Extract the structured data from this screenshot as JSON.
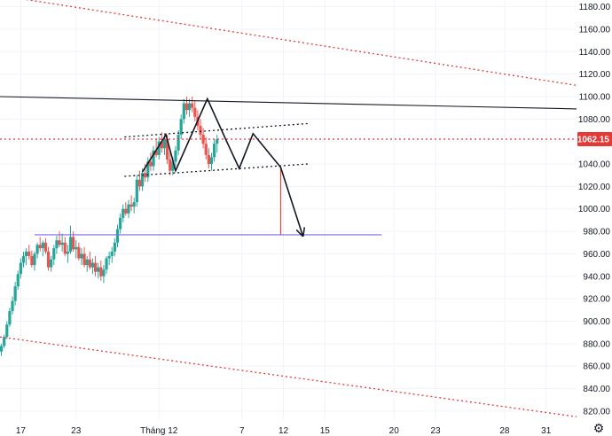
{
  "chart_data": {
    "type": "candlestick",
    "y_ticks": [
      820,
      840,
      860,
      880,
      900,
      920,
      940,
      960,
      980,
      1000,
      1020,
      1040,
      1060,
      1080,
      1100,
      1120,
      1140,
      1160,
      1180
    ],
    "y_tick_labels": [
      "820.00",
      "840.00",
      "860.00",
      "880.00",
      "900.00",
      "920.00",
      "940.00",
      "960.00",
      "980.00",
      "1000.00",
      "1020.00",
      "1040.00",
      "1060.00",
      "1080.00",
      "1100.00",
      "1120.00",
      "1140.00",
      "1160.00",
      "1180.00"
    ],
    "ylim": [
      812,
      1186
    ],
    "x_ticks": [
      {
        "label": "17",
        "x": 0
      },
      {
        "label": "23",
        "x": 4
      },
      {
        "label": "Tháng 12",
        "x": 10
      },
      {
        "label": "7",
        "x": 16
      },
      {
        "label": "12",
        "x": 19
      },
      {
        "label": "15",
        "x": 22
      },
      {
        "label": "20",
        "x": 27
      },
      {
        "label": "23",
        "x": 30
      },
      {
        "label": "28",
        "x": 35
      },
      {
        "label": "31",
        "x": 38
      }
    ],
    "xlim": [
      -1.5,
      40.2
    ],
    "current_price": 1062.15,
    "current_price_label": "1062.15",
    "up_color": "#26a69a",
    "down_color": "#ef5350",
    "candles": [
      [
        -1.4,
        873,
        880,
        869,
        878
      ],
      [
        -1.2,
        878,
        888,
        876,
        886
      ],
      [
        -1.0,
        886,
        900,
        884,
        897
      ],
      [
        -0.8,
        897,
        912,
        895,
        909
      ],
      [
        -0.6,
        909,
        922,
        906,
        918
      ],
      [
        -0.4,
        918,
        935,
        914,
        931
      ],
      [
        -0.2,
        931,
        945,
        928,
        942
      ],
      [
        0.0,
        942,
        956,
        938,
        952
      ],
      [
        0.2,
        952,
        962,
        948,
        958
      ],
      [
        0.4,
        958,
        965,
        950,
        962
      ],
      [
        0.6,
        962,
        968,
        955,
        958
      ],
      [
        0.8,
        958,
        963,
        948,
        950
      ],
      [
        1.0,
        950,
        962,
        945,
        960
      ],
      [
        1.2,
        960,
        970,
        956,
        968
      ],
      [
        1.4,
        968,
        975,
        962,
        965
      ],
      [
        1.6,
        965,
        972,
        958,
        970
      ],
      [
        1.8,
        970,
        974,
        960,
        962
      ],
      [
        2.0,
        962,
        966,
        945,
        948
      ],
      [
        2.2,
        948,
        958,
        944,
        955
      ],
      [
        2.4,
        955,
        968,
        950,
        965
      ],
      [
        2.6,
        965,
        976,
        960,
        972
      ],
      [
        2.8,
        972,
        980,
        966,
        968
      ],
      [
        3.0,
        968,
        978,
        962,
        970
      ],
      [
        3.2,
        970,
        975,
        958,
        960
      ],
      [
        3.4,
        960,
        968,
        952,
        962
      ],
      [
        3.6,
        962,
        985,
        960,
        975
      ],
      [
        3.8,
        975,
        980,
        962,
        964
      ],
      [
        4.0,
        964,
        972,
        956,
        966
      ],
      [
        4.2,
        966,
        970,
        954,
        956
      ],
      [
        4.4,
        956,
        965,
        950,
        960
      ],
      [
        4.6,
        960,
        966,
        948,
        950
      ],
      [
        4.8,
        950,
        958,
        944,
        955
      ],
      [
        5.0,
        955,
        962,
        946,
        948
      ],
      [
        5.2,
        948,
        956,
        942,
        952
      ],
      [
        5.4,
        952,
        958,
        940,
        944
      ],
      [
        5.6,
        944,
        952,
        938,
        948
      ],
      [
        5.8,
        948,
        954,
        936,
        940
      ],
      [
        6.0,
        940,
        950,
        934,
        946
      ],
      [
        6.2,
        946,
        958,
        942,
        956
      ],
      [
        6.4,
        956,
        962,
        950,
        958
      ],
      [
        6.6,
        958,
        966,
        952,
        962
      ],
      [
        6.8,
        962,
        974,
        958,
        970
      ],
      [
        7.0,
        970,
        986,
        966,
        982
      ],
      [
        7.2,
        982,
        996,
        978,
        992
      ],
      [
        7.4,
        992,
        1004,
        988,
        1000
      ],
      [
        7.6,
        1000,
        1006,
        994,
        996
      ],
      [
        7.8,
        996,
        1008,
        992,
        1004
      ],
      [
        8.0,
        1004,
        1012,
        998,
        1002
      ],
      [
        8.2,
        1002,
        1010,
        996,
        1006
      ],
      [
        8.4,
        1006,
        1030,
        1002,
        1026
      ],
      [
        8.6,
        1026,
        1034,
        1016,
        1020
      ],
      [
        8.8,
        1020,
        1036,
        1016,
        1032
      ],
      [
        9.0,
        1032,
        1040,
        1024,
        1028
      ],
      [
        9.2,
        1028,
        1046,
        1024,
        1042
      ],
      [
        9.4,
        1042,
        1050,
        1034,
        1038
      ],
      [
        9.6,
        1038,
        1056,
        1034,
        1052
      ],
      [
        9.8,
        1052,
        1062,
        1046,
        1048
      ],
      [
        10.0,
        1048,
        1064,
        1044,
        1060
      ],
      [
        10.2,
        1060,
        1068,
        1050,
        1054
      ],
      [
        10.4,
        1054,
        1066,
        1048,
        1062
      ],
      [
        10.6,
        1062,
        1066,
        1040,
        1044
      ],
      [
        10.8,
        1044,
        1052,
        1030,
        1034
      ],
      [
        11.0,
        1034,
        1046,
        1030,
        1042
      ],
      [
        11.2,
        1042,
        1056,
        1038,
        1052
      ],
      [
        11.4,
        1052,
        1070,
        1048,
        1066
      ],
      [
        11.6,
        1066,
        1084,
        1062,
        1080
      ],
      [
        11.8,
        1080,
        1098,
        1076,
        1094
      ],
      [
        12.0,
        1094,
        1100,
        1084,
        1088
      ],
      [
        12.2,
        1088,
        1098,
        1082,
        1094
      ],
      [
        12.4,
        1094,
        1100,
        1086,
        1090
      ],
      [
        12.6,
        1090,
        1096,
        1078,
        1082
      ],
      [
        12.8,
        1082,
        1088,
        1070,
        1074
      ],
      [
        13.0,
        1074,
        1080,
        1062,
        1066
      ],
      [
        13.2,
        1066,
        1072,
        1054,
        1058
      ],
      [
        13.4,
        1058,
        1064,
        1044,
        1048
      ],
      [
        13.6,
        1048,
        1054,
        1036,
        1040
      ],
      [
        13.8,
        1040,
        1050,
        1034,
        1046
      ],
      [
        14.0,
        1046,
        1062,
        1042,
        1058
      ],
      [
        14.2,
        1058,
        1066,
        1050,
        1062
      ]
    ],
    "annotations": [
      {
        "name": "upper-channel-line",
        "kind": "line",
        "color": "#e53935",
        "dash": "dotted",
        "points": [
          [
            -1.5,
            1190
          ],
          [
            40.2,
            1110
          ]
        ]
      },
      {
        "name": "lower-channel-line",
        "kind": "line",
        "color": "#e53935",
        "dash": "dotted",
        "points": [
          [
            -1.5,
            886
          ],
          [
            40.2,
            815
          ]
        ]
      },
      {
        "name": "resistance-line",
        "kind": "line",
        "color": "#131722",
        "dash": "solid",
        "points": [
          [
            -1.5,
            1100
          ],
          [
            40.2,
            1089
          ]
        ]
      },
      {
        "name": "neckline-upper",
        "kind": "line",
        "color": "#131722",
        "dash": "dotted",
        "points": [
          [
            7.5,
            1064
          ],
          [
            20.8,
            1076
          ]
        ]
      },
      {
        "name": "neckline-lower",
        "kind": "line",
        "color": "#131722",
        "dash": "dotted",
        "points": [
          [
            7.5,
            1029
          ],
          [
            20.8,
            1040
          ]
        ]
      },
      {
        "name": "support-line",
        "kind": "line",
        "color": "#7b68ee",
        "dash": "solid",
        "points": [
          [
            1.0,
            977
          ],
          [
            26.1,
            977
          ]
        ]
      },
      {
        "name": "projection-line",
        "kind": "line",
        "color": "#e53935",
        "dash": "solid",
        "points": [
          [
            18.8,
            1037
          ],
          [
            18.8,
            977
          ]
        ]
      },
      {
        "name": "current-price-line",
        "kind": "line",
        "color": "#e53935",
        "dash": "dotted",
        "points": [
          [
            -1.5,
            1062.15
          ],
          [
            40.2,
            1062.15
          ]
        ]
      },
      {
        "name": "pattern-zigzag",
        "kind": "polyline",
        "color": "#131722",
        "dash": "solid",
        "points": [
          [
            8.8,
            1033
          ],
          [
            10.5,
            1066
          ],
          [
            11.2,
            1034
          ],
          [
            13.5,
            1098
          ],
          [
            14.9,
            1060
          ],
          [
            15.8,
            1036
          ],
          [
            16.8,
            1067
          ],
          [
            18.8,
            1037
          ],
          [
            20.4,
            976
          ]
        ],
        "arrow_end": true
      }
    ]
  }
}
